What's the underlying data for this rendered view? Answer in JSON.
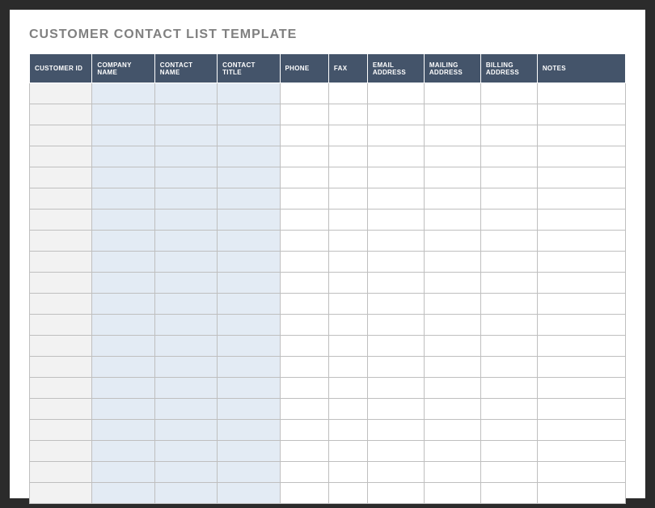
{
  "title": "CUSTOMER CONTACT LIST TEMPLATE",
  "columns": [
    "CUSTOMER ID",
    "COMPANY NAME",
    "CONTACT NAME",
    "CONTACT TITLE",
    "PHONE",
    "FAX",
    "EMAIL ADDRESS",
    "MAILING ADDRESS",
    "BILLING ADDRESS",
    "NOTES"
  ],
  "row_count": 20,
  "rows": [
    [
      "",
      "",
      "",
      "",
      "",
      "",
      "",
      "",
      "",
      ""
    ],
    [
      "",
      "",
      "",
      "",
      "",
      "",
      "",
      "",
      "",
      ""
    ],
    [
      "",
      "",
      "",
      "",
      "",
      "",
      "",
      "",
      "",
      ""
    ],
    [
      "",
      "",
      "",
      "",
      "",
      "",
      "",
      "",
      "",
      ""
    ],
    [
      "",
      "",
      "",
      "",
      "",
      "",
      "",
      "",
      "",
      ""
    ],
    [
      "",
      "",
      "",
      "",
      "",
      "",
      "",
      "",
      "",
      ""
    ],
    [
      "",
      "",
      "",
      "",
      "",
      "",
      "",
      "",
      "",
      ""
    ],
    [
      "",
      "",
      "",
      "",
      "",
      "",
      "",
      "",
      "",
      ""
    ],
    [
      "",
      "",
      "",
      "",
      "",
      "",
      "",
      "",
      "",
      ""
    ],
    [
      "",
      "",
      "",
      "",
      "",
      "",
      "",
      "",
      "",
      ""
    ],
    [
      "",
      "",
      "",
      "",
      "",
      "",
      "",
      "",
      "",
      ""
    ],
    [
      "",
      "",
      "",
      "",
      "",
      "",
      "",
      "",
      "",
      ""
    ],
    [
      "",
      "",
      "",
      "",
      "",
      "",
      "",
      "",
      "",
      ""
    ],
    [
      "",
      "",
      "",
      "",
      "",
      "",
      "",
      "",
      "",
      ""
    ],
    [
      "",
      "",
      "",
      "",
      "",
      "",
      "",
      "",
      "",
      ""
    ],
    [
      "",
      "",
      "",
      "",
      "",
      "",
      "",
      "",
      "",
      ""
    ],
    [
      "",
      "",
      "",
      "",
      "",
      "",
      "",
      "",
      "",
      ""
    ],
    [
      "",
      "",
      "",
      "",
      "",
      "",
      "",
      "",
      "",
      ""
    ],
    [
      "",
      "",
      "",
      "",
      "",
      "",
      "",
      "",
      "",
      ""
    ],
    [
      "",
      "",
      "",
      "",
      "",
      "",
      "",
      "",
      "",
      ""
    ]
  ],
  "colors": {
    "frame": "#2b2b2b",
    "page_bg": "#ffffff",
    "title_text": "#808080",
    "header_bg": "#44546a",
    "header_text": "#ffffff",
    "id_col_bg": "#f2f2f2",
    "name_cols_bg": "#e3ebf4",
    "cell_border": "#bfbfbf"
  }
}
